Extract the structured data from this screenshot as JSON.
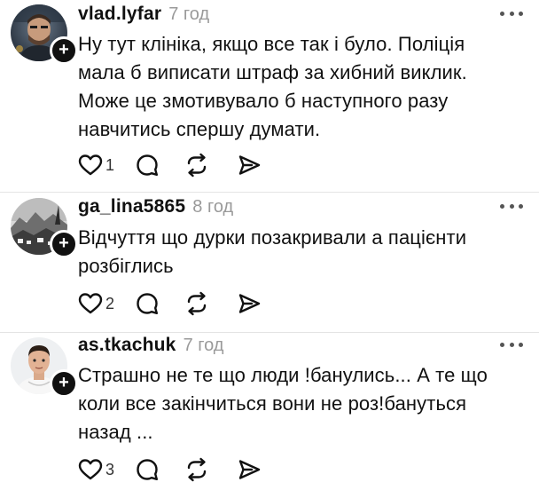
{
  "posts": [
    {
      "username": "vlad.lyfar",
      "time": "7 год",
      "lines": [
        "Ну тут клініка, якщо все так і було. Поліція",
        "мала б виписати штраф за хибний виклик.",
        "Може це змотивувало б наступного разу",
        "навчитись спершу думати."
      ],
      "likes": "1",
      "icons": [
        "avatar-photo",
        "follow-plus-icon",
        "more-dots-icon",
        "heart-icon",
        "comment-icon",
        "repost-icon",
        "share-icon"
      ]
    },
    {
      "username": "ga_lina5865",
      "time": "8 год",
      "lines": [
        "Відчуття що дурки позакривали а пацієнти",
        "розбіглись"
      ],
      "likes": "2",
      "icons": [
        "avatar-photo",
        "follow-plus-icon",
        "more-dots-icon",
        "heart-icon",
        "comment-icon",
        "repost-icon",
        "share-icon"
      ]
    },
    {
      "username": "as.tkachuk",
      "time": "7 год",
      "lines": [
        "Страшно не те що люди !банулись... А те що",
        "коли все закінчиться вони не роз!бануться",
        "назад ..."
      ],
      "likes": "3",
      "icons": [
        "avatar-photo",
        "follow-plus-icon",
        "more-dots-icon",
        "heart-icon",
        "comment-icon",
        "repost-icon",
        "share-icon"
      ]
    }
  ],
  "colors": {
    "text": "#111111",
    "muted": "#9a9a9a",
    "divider": "#e4e4e4",
    "icon": "#111111"
  }
}
